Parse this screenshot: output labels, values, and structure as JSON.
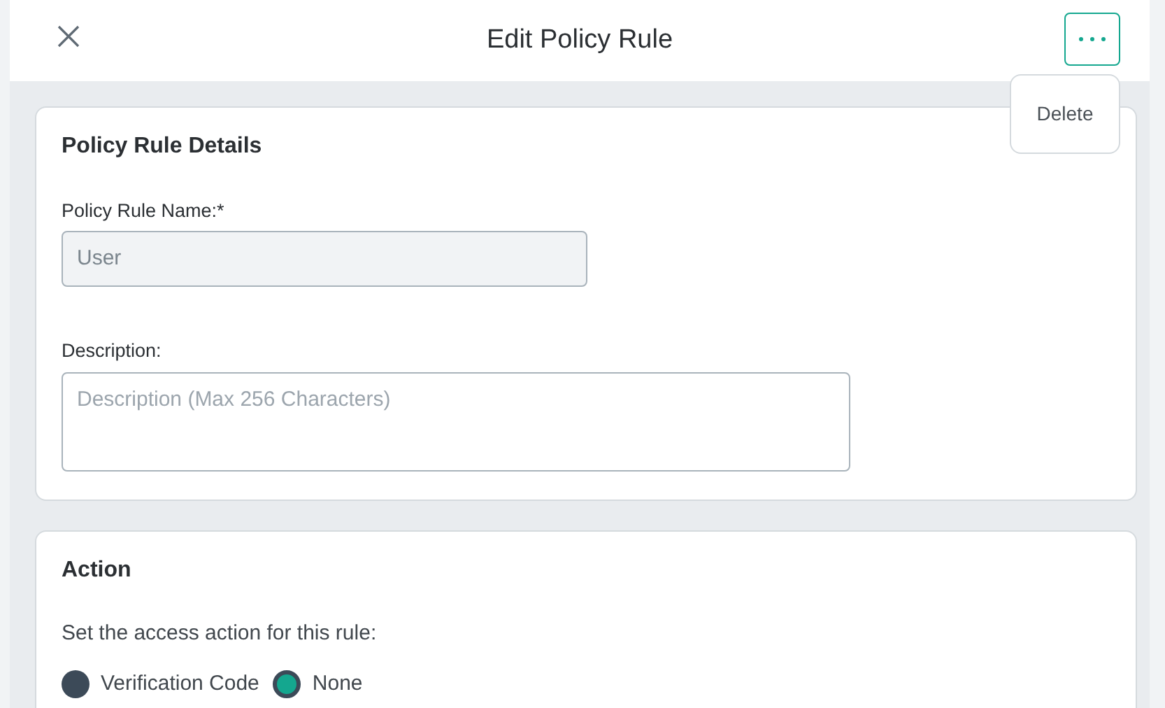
{
  "header": {
    "title": "Edit Policy Rule"
  },
  "menu": {
    "open": true,
    "items": [
      "Delete"
    ]
  },
  "details": {
    "title": "Policy Rule Details",
    "name_label": "Policy Rule Name:*",
    "name_value": "User",
    "description_label": "Description:",
    "description_placeholder": "Description (Max 256 Characters)"
  },
  "action": {
    "title": "Action",
    "prompt": "Set the access action for this rule:",
    "options": [
      {
        "label": "Verification Code",
        "selected": false
      },
      {
        "label": "None",
        "selected": true
      }
    ]
  }
}
